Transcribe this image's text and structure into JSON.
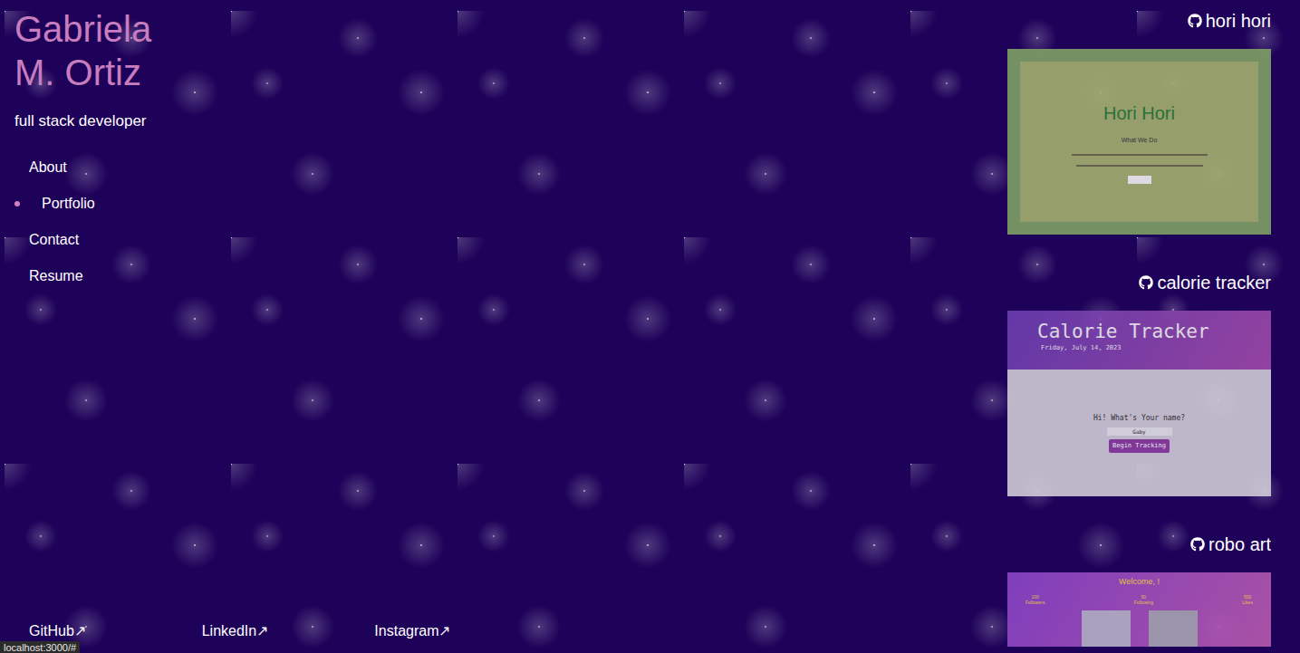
{
  "header": {
    "name": "Gabriela M. Ortiz",
    "subtitle": "full stack developer"
  },
  "nav": [
    {
      "label": "About",
      "selected": false
    },
    {
      "label": "Portfolio",
      "selected": true
    },
    {
      "label": "Contact",
      "selected": false
    },
    {
      "label": "Resume",
      "selected": false
    }
  ],
  "social_links": [
    {
      "label": "GitHub↗"
    },
    {
      "label": "LinkedIn↗"
    },
    {
      "label": "Instagram↗"
    }
  ],
  "projects": [
    {
      "title": "hori hori",
      "preview": {
        "kind": "garden",
        "heading": "Hori Hori",
        "subheading": "What We Do"
      }
    },
    {
      "title": "calorie tracker",
      "preview": {
        "kind": "tracker",
        "heading": "Calorie Tracker",
        "date": "Friday, July 14, 2023",
        "prompt": "Hi! What's Your name?",
        "input": "Gaby",
        "button": "Begin Tracking"
      }
    },
    {
      "title": "robo art",
      "preview": {
        "kind": "gallery",
        "heading": "Welcome, !",
        "stats": [
          {
            "value": "100",
            "label": "Followers"
          },
          {
            "value": "50",
            "label": "Following"
          },
          {
            "value": "500",
            "label": "Likes"
          }
        ]
      }
    }
  ],
  "status_bar": {
    "url": "localhost:3000/#"
  }
}
